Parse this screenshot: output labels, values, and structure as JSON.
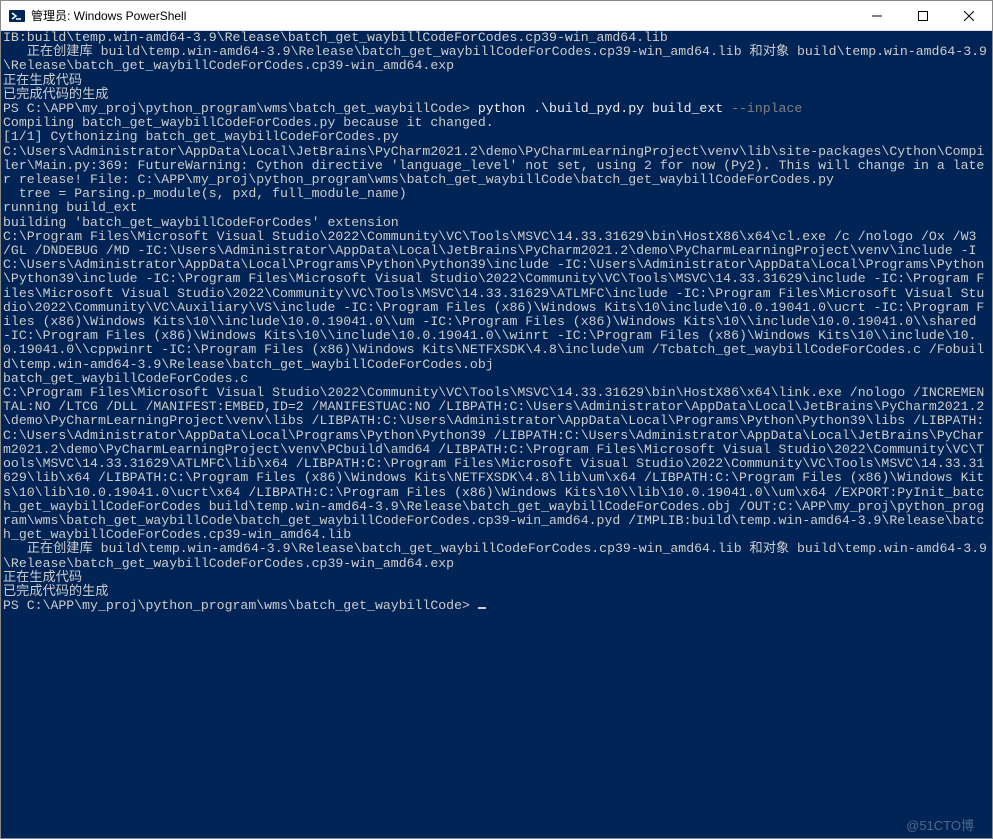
{
  "window": {
    "title": "管理员: Windows PowerShell"
  },
  "terminal": {
    "line_1": "IB:build\\temp.win-amd64-3.9\\Release\\batch_get_waybillCodeForCodes.cp39-win_amd64.lib",
    "line_2": "   正在创建库 build\\temp.win-amd64-3.9\\Release\\batch_get_waybillCodeForCodes.cp39-win_amd64.lib 和对象 build\\temp.win-amd64-3.9\\Release\\batch_get_waybillCodeForCodes.cp39-win_amd64.exp",
    "line_3": "正在生成代码",
    "line_4": "已完成代码的生成",
    "prompt_1_path": "PS C:\\APP\\my_proj\\python_program\\wms\\batch_get_waybillCode> ",
    "prompt_1_cmd": "python .\\build_pyd.py build_ext ",
    "prompt_1_flag": "--inplace",
    "line_5": "Compiling batch_get_waybillCodeForCodes.py because it changed.",
    "line_6": "[1/1] Cythonizing batch_get_waybillCodeForCodes.py",
    "line_7": "C:\\Users\\Administrator\\AppData\\Local\\JetBrains\\PyCharm2021.2\\demo\\PyCharmLearningProject\\venv\\lib\\site-packages\\Cython\\Compiler\\Main.py:369: FutureWarning: Cython directive 'language_level' not set, using 2 for now (Py2). This will change in a later release! File: C:\\APP\\my_proj\\python_program\\wms\\batch_get_waybillCode\\batch_get_waybillCodeForCodes.py",
    "line_8": "  tree = Parsing.p_module(s, pxd, full_module_name)",
    "line_9": "running build_ext",
    "line_10": "building 'batch_get_waybillCodeForCodes' extension",
    "line_11": "C:\\Program Files\\Microsoft Visual Studio\\2022\\Community\\VC\\Tools\\MSVC\\14.33.31629\\bin\\HostX86\\x64\\cl.exe /c /nologo /Ox /W3 /GL /DNDEBUG /MD -IC:\\Users\\Administrator\\AppData\\Local\\JetBrains\\PyCharm2021.2\\demo\\PyCharmLearningProject\\venv\\include -IC:\\Users\\Administrator\\AppData\\Local\\Programs\\Python\\Python39\\include -IC:\\Users\\Administrator\\AppData\\Local\\Programs\\Python\\Python39\\include -IC:\\Program Files\\Microsoft Visual Studio\\2022\\Community\\VC\\Tools\\MSVC\\14.33.31629\\include -IC:\\Program Files\\Microsoft Visual Studio\\2022\\Community\\VC\\Tools\\MSVC\\14.33.31629\\ATLMFC\\include -IC:\\Program Files\\Microsoft Visual Studio\\2022\\Community\\VC\\Auxiliary\\VS\\include -IC:\\Program Files (x86)\\Windows Kits\\10\\include\\10.0.19041.0\\ucrt -IC:\\Program Files (x86)\\Windows Kits\\10\\\\include\\10.0.19041.0\\\\um -IC:\\Program Files (x86)\\Windows Kits\\10\\\\include\\10.0.19041.0\\\\shared -IC:\\Program Files (x86)\\Windows Kits\\10\\\\include\\10.0.19041.0\\\\winrt -IC:\\Program Files (x86)\\Windows Kits\\10\\\\include\\10.0.19041.0\\\\cppwinrt -IC:\\Program Files (x86)\\Windows Kits\\NETFXSDK\\4.8\\include\\um /Tcbatch_get_waybillCodeForCodes.c /Fobuild\\temp.win-amd64-3.9\\Release\\batch_get_waybillCodeForCodes.obj",
    "line_12": "batch_get_waybillCodeForCodes.c",
    "line_13": "C:\\Program Files\\Microsoft Visual Studio\\2022\\Community\\VC\\Tools\\MSVC\\14.33.31629\\bin\\HostX86\\x64\\link.exe /nologo /INCREMENTAL:NO /LTCG /DLL /MANIFEST:EMBED,ID=2 /MANIFESTUAC:NO /LIBPATH:C:\\Users\\Administrator\\AppData\\Local\\JetBrains\\PyCharm2021.2\\demo\\PyCharmLearningProject\\venv\\libs /LIBPATH:C:\\Users\\Administrator\\AppData\\Local\\Programs\\Python\\Python39\\libs /LIBPATH:C:\\Users\\Administrator\\AppData\\Local\\Programs\\Python\\Python39 /LIBPATH:C:\\Users\\Administrator\\AppData\\Local\\JetBrains\\PyCharm2021.2\\demo\\PyCharmLearningProject\\venv\\PCbuild\\amd64 /LIBPATH:C:\\Program Files\\Microsoft Visual Studio\\2022\\Community\\VC\\Tools\\MSVC\\14.33.31629\\ATLMFC\\lib\\x64 /LIBPATH:C:\\Program Files\\Microsoft Visual Studio\\2022\\Community\\VC\\Tools\\MSVC\\14.33.31629\\lib\\x64 /LIBPATH:C:\\Program Files (x86)\\Windows Kits\\NETFXSDK\\4.8\\lib\\um\\x64 /LIBPATH:C:\\Program Files (x86)\\Windows Kits\\10\\lib\\10.0.19041.0\\ucrt\\x64 /LIBPATH:C:\\Program Files (x86)\\Windows Kits\\10\\\\lib\\10.0.19041.0\\\\um\\x64 /EXPORT:PyInit_batch_get_waybillCodeForCodes build\\temp.win-amd64-3.9\\Release\\batch_get_waybillCodeForCodes.obj /OUT:C:\\APP\\my_proj\\python_program\\wms\\batch_get_waybillCode\\batch_get_waybillCodeForCodes.cp39-win_amd64.pyd /IMPLIB:build\\temp.win-amd64-3.9\\Release\\batch_get_waybillCodeForCodes.cp39-win_amd64.lib",
    "line_14": "   正在创建库 build\\temp.win-amd64-3.9\\Release\\batch_get_waybillCodeForCodes.cp39-win_amd64.lib 和对象 build\\temp.win-amd64-3.9\\Release\\batch_get_waybillCodeForCodes.cp39-win_amd64.exp",
    "line_15": "正在生成代码",
    "line_16": "已完成代码的生成",
    "prompt_2_path": "PS C:\\APP\\my_proj\\python_program\\wms\\batch_get_waybillCode> "
  },
  "watermark": "@51CTO博"
}
